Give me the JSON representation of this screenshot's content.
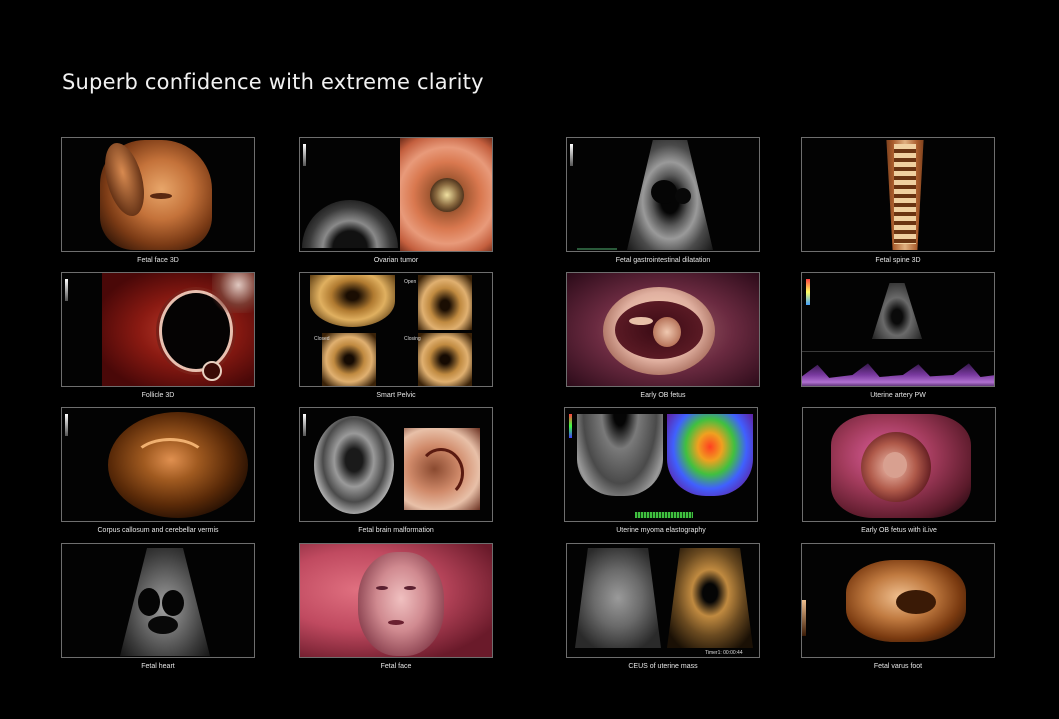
{
  "page": {
    "title": "Superb confidence with extreme clarity"
  },
  "images": [
    {
      "caption": "Fetal face 3D",
      "icon": "fetal-face-3d-image"
    },
    {
      "caption": "Ovarian tumor",
      "icon": "ovarian-tumor-image"
    },
    {
      "caption": "Fetal gastrointestinal dilatation",
      "icon": "fetal-gi-dilatation-image"
    },
    {
      "caption": "Fetal spine 3D",
      "icon": "fetal-spine-3d-image"
    },
    {
      "caption": "Follicle 3D",
      "icon": "follicle-3d-image"
    },
    {
      "caption": "Smart Pelvic",
      "icon": "smart-pelvic-image",
      "panel_labels": [
        "Open",
        "Closed",
        "Closing"
      ]
    },
    {
      "caption": "Early OB fetus",
      "icon": "early-ob-fetus-image"
    },
    {
      "caption": "Uterine artery PW",
      "icon": "uterine-artery-pw-image"
    },
    {
      "caption": "Corpus callosum and cerebellar vermis",
      "icon": "corpus-callosum-image"
    },
    {
      "caption": "Fetal brain malformation",
      "icon": "fetal-brain-malformation-image"
    },
    {
      "caption": "Uterine myoma elastography",
      "icon": "uterine-myoma-elastography-image"
    },
    {
      "caption": "Early OB fetus with iLive",
      "icon": "early-ob-fetus-ilive-image"
    },
    {
      "caption": "Fetal heart",
      "icon": "fetal-heart-image"
    },
    {
      "caption": "Fetal face",
      "icon": "fetal-face-image"
    },
    {
      "caption": "CEUS of uterine mass",
      "icon": "ceus-uterine-mass-image",
      "timer_text": "Timer1: 00:00:44"
    },
    {
      "caption": "Fetal varus foot",
      "icon": "fetal-varus-foot-image"
    }
  ],
  "colors": {
    "background": "#000000",
    "frame_border": "#6e6e6e",
    "text": "#f2f2f2"
  }
}
